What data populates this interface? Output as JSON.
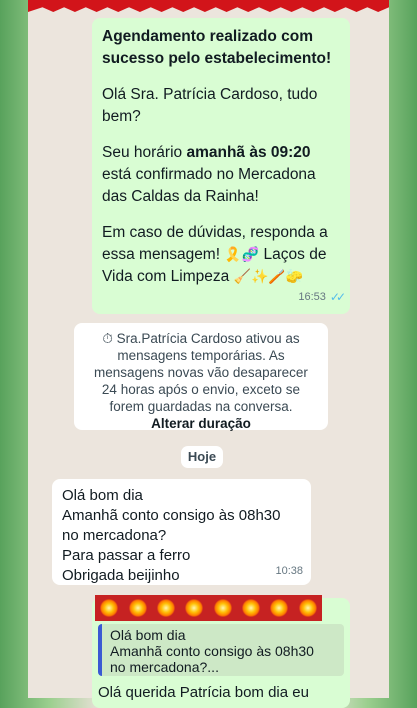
{
  "outgoing_message": {
    "heading": "Agendamento realizado com sucesso pelo estabelecimento!",
    "greeting": "Olá Sra. Patrícia Cardoso, tudo bem?",
    "confirm_prefix": "Seu horário",
    "confirm_bold": "amanhã às 09:20",
    "confirm_suffix": "está confirmado no Mercadona das Caldas da Rainha!",
    "help_line1": "Em caso de dúvidas, responda a essa mensagem!",
    "help_emoji1": "🎗️🧬",
    "help_brand": "Laços de Vida com Limpeza",
    "help_emoji2": "🧹✨🪥🧽",
    "time": "16:53",
    "status": "✓✓"
  },
  "system_notice": {
    "icon": "timer-icon",
    "text": "Sra.Patrícia Cardoso ativou as mensagens temporárias. As mensagens novas vão desaparecer 24 horas após o envio, exceto se forem guardadas na conversa.",
    "link": "Alterar duração"
  },
  "date_separator": "Hoje",
  "incoming_message": {
    "lines": [
      "Olá bom dia",
      "Amanhã conto consigo às 08h30",
      "no mercadona?",
      "Para passar a ferro",
      "Obrigada beijinho"
    ],
    "time": "10:38"
  },
  "reply_message": {
    "quoted_lines": [
      "Olá bom dia",
      "Amanhã conto consigo às 08h30",
      "no mercadona?..."
    ],
    "text": "Olá querida Patrícia bom dia eu"
  },
  "colors": {
    "outgoing_bubble": "#d9fdd3",
    "chat_background": "#ece5dd",
    "read_ticks": "#53bdeb",
    "quote_bar": "#3a5ad3"
  }
}
